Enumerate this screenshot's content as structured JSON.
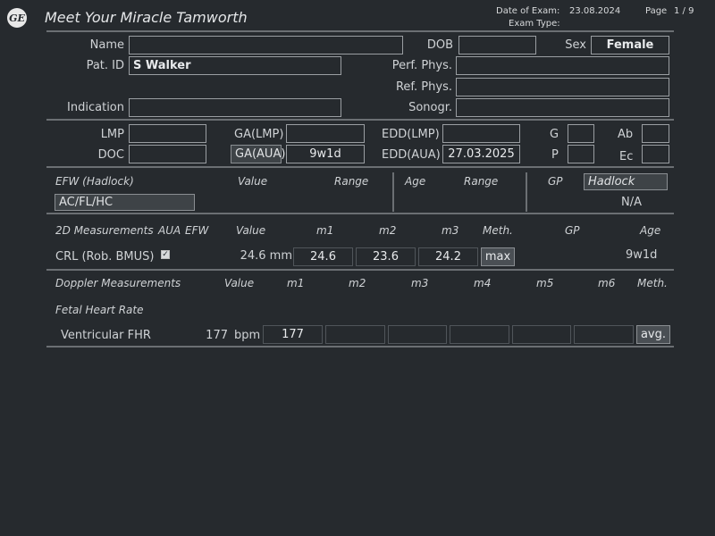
{
  "header": {
    "logo_text": "GE",
    "title": "Meet Your Miracle Tamworth",
    "date_label": "Date of Exam:",
    "date_value": "23.08.2024",
    "page_label": "Page",
    "page_value": "1 / 9",
    "exam_type_label": "Exam Type:"
  },
  "patient": {
    "name_label": "Name",
    "name_value": "",
    "dob_label": "DOB",
    "dob_value": "",
    "sex_label": "Sex",
    "sex_value": "Female",
    "patid_label": "Pat. ID",
    "patid_value": "S Walker",
    "perf_label": "Perf. Phys.",
    "perf_value": "",
    "ref_label": "Ref. Phys.",
    "ref_value": "",
    "indication_label": "Indication",
    "indication_value": "",
    "sonogr_label": "Sonogr.",
    "sonogr_value": ""
  },
  "dating": {
    "lmp_label": "LMP",
    "lmp_value": "",
    "doc_label": "DOC",
    "doc_value": "",
    "galmp_label": "GA(LMP)",
    "galmp_value": "",
    "gaaua_label": "GA(AUA)",
    "gaaua_value": "9w1d",
    "eddlmp_label": "EDD(LMP)",
    "eddlmp_value": "",
    "eddaua_label": "EDD(AUA)",
    "eddaua_value": "27.03.2025",
    "g_label": "G",
    "g_value": "",
    "p_label": "P",
    "p_value": "",
    "ab_label": "Ab",
    "ab_value": "",
    "ec_label": "Ec",
    "ec_value": ""
  },
  "efw": {
    "header": "EFW (Hadlock)",
    "col_value": "Value",
    "col_range": "Range",
    "col_age": "Age",
    "col_range2": "Range",
    "col_gp": "GP",
    "gp_select": "Hadlock",
    "formula": "AC/FL/HC",
    "gp_value": "N/A"
  },
  "measurements_2d": {
    "header": "2D Measurements",
    "col_aua": "AUA",
    "col_efw": "EFW",
    "col_value": "Value",
    "col_m1": "m1",
    "col_m2": "m2",
    "col_m3": "m3",
    "col_meth": "Meth.",
    "col_gp": "GP",
    "col_age": "Age",
    "row": {
      "name": "CRL (Rob. BMUS)",
      "aua_checked": true,
      "value": "24.6 mm",
      "m1": "24.6",
      "m2": "23.6",
      "m3": "24.2",
      "meth": "max",
      "age": "9w1d"
    }
  },
  "doppler": {
    "header": "Doppler Measurements",
    "col_value": "Value",
    "col_m1": "m1",
    "col_m2": "m2",
    "col_m3": "m3",
    "col_m4": "m4",
    "col_m5": "m5",
    "col_m6": "m6",
    "col_meth": "Meth.",
    "sub_header": "Fetal Heart Rate",
    "row": {
      "name": "Ventricular FHR",
      "value": "177",
      "unit": "bpm",
      "m1": "177",
      "m2": "",
      "m3": "",
      "m4": "",
      "m5": "",
      "m6": "",
      "meth": "avg."
    }
  }
}
